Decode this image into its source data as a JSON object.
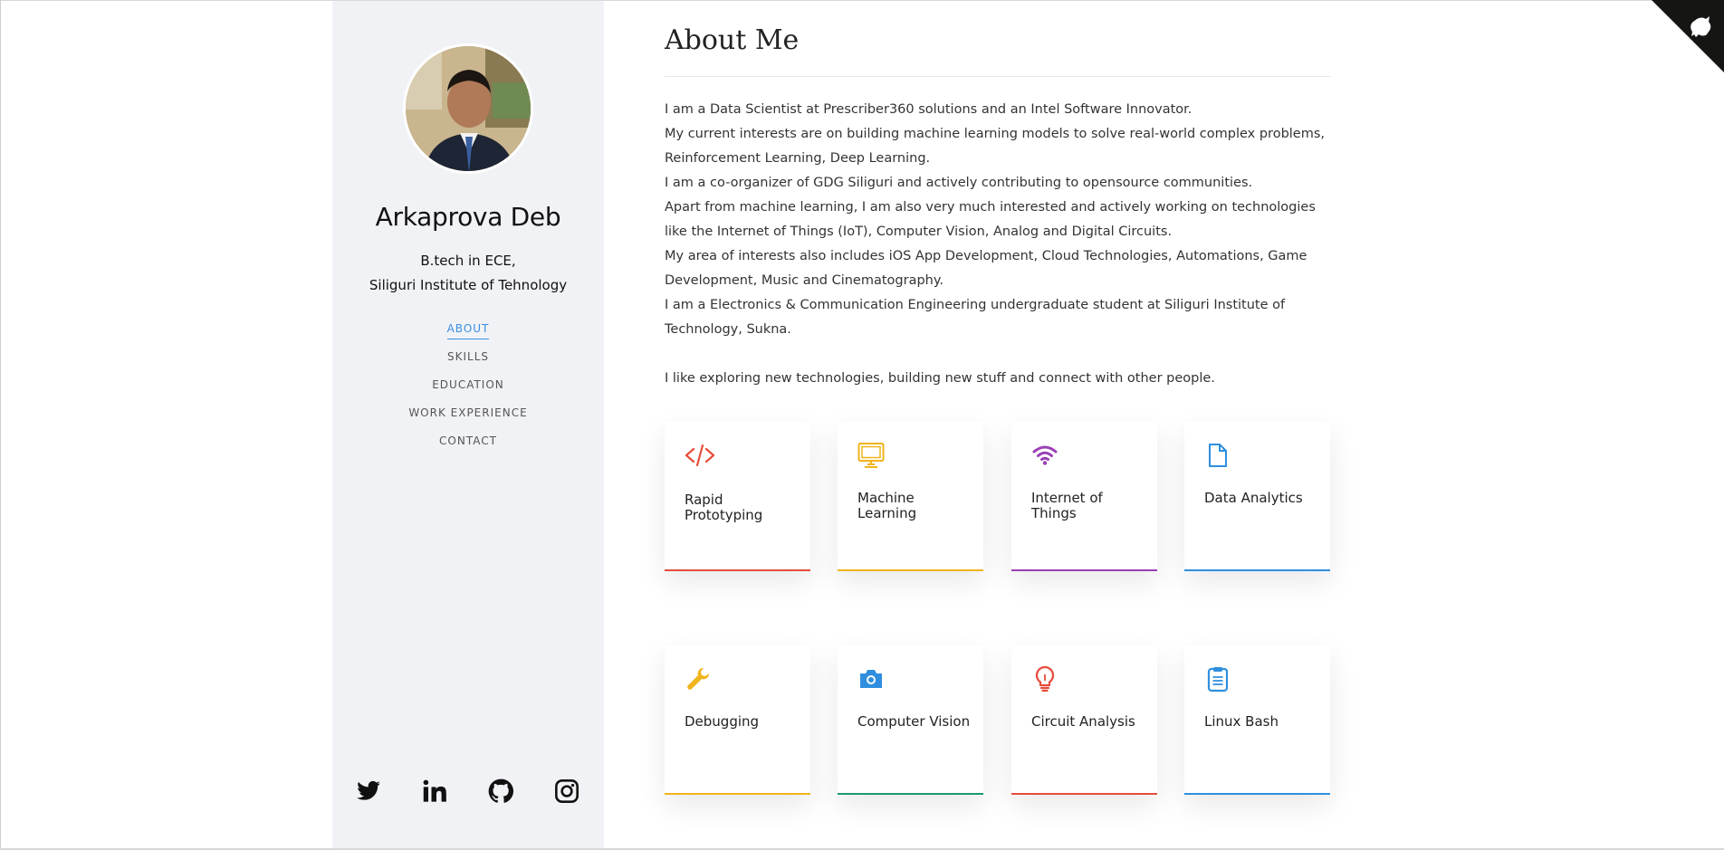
{
  "profile": {
    "name": "Arkaprova Deb",
    "degree": "B.tech in ECE,",
    "institute": "Siliguri Institute of Tehnology"
  },
  "nav": {
    "items": [
      {
        "label": "ABOUT",
        "active": true
      },
      {
        "label": "SKILLS",
        "active": false
      },
      {
        "label": "EDUCATION",
        "active": false
      },
      {
        "label": "WORK EXPERIENCE",
        "active": false
      },
      {
        "label": "CONTACT",
        "active": false
      }
    ]
  },
  "social": [
    "twitter-icon",
    "linkedin-icon",
    "github-icon",
    "instagram-icon"
  ],
  "main": {
    "title": "About Me",
    "paragraphs": [
      "I am a Data Scientist at Prescriber360 solutions and an Intel Software Innovator.",
      "My current interests are on building machine learning models to solve real-world complex problems, Reinforcement Learning, Deep Learning.",
      "I am a co-organizer of GDG Siliguri and actively contributing to opensource communities.",
      "Apart from machine learning, I am also very much interested and actively working on technologies like the Internet of Things (IoT), Computer Vision, Analog and Digital Circuits.",
      "My area of interests also includes iOS App Development, Cloud Technologies, Automations, Game Development, Music and Cinematography.",
      "I am a Electronics & Communication Engineering undergraduate student at Siliguri Institute of Technology, Sukna."
    ],
    "closing": "I like exploring new technologies, building new stuff and connect with other people."
  },
  "cards": [
    {
      "label": "Rapid Prototyping",
      "icon": "code-icon",
      "color": "#e74c3c"
    },
    {
      "label": "Machine Learning",
      "icon": "monitor-icon",
      "color": "#f0b41c"
    },
    {
      "label": "Internet of Things",
      "icon": "wifi-icon",
      "color": "#9b3fb5"
    },
    {
      "label": "Data Analytics",
      "icon": "document-icon",
      "color": "#2f8fde"
    },
    {
      "label": "Debugging",
      "icon": "wrench-icon",
      "color": "#f0b41c"
    },
    {
      "label": "Computer Vision",
      "icon": "camera-icon",
      "color": "#1a9a6e"
    },
    {
      "label": "Circuit Analysis",
      "icon": "lightbulb-icon",
      "color": "#e74c3c"
    },
    {
      "label": "Linux Bash",
      "icon": "clipboard-icon",
      "color": "#2f8fde"
    }
  ],
  "colors": {
    "accent": "#3a8ee6",
    "sidebar_bg": "#f1f2f5"
  }
}
